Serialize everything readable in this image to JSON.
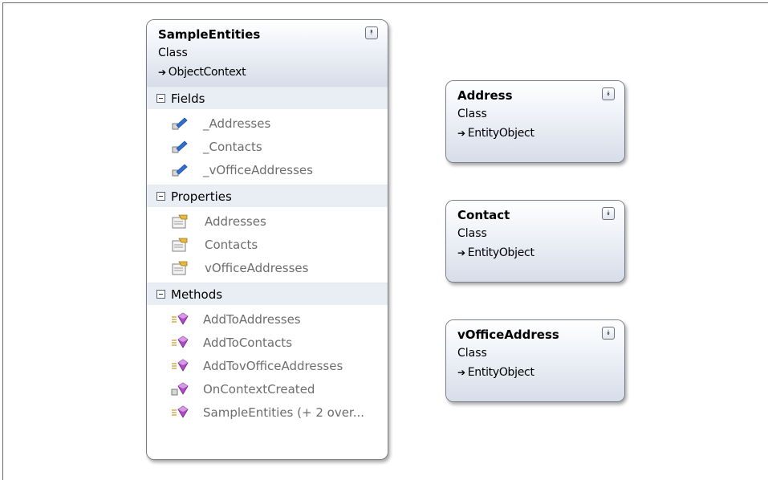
{
  "classes": {
    "sample_entities": {
      "name": "SampleEntities",
      "kind": "Class",
      "base": "ObjectContext",
      "sections": {
        "fields": {
          "title": "Fields",
          "items": [
            "_Addresses",
            "_Contacts",
            "_vOfficeAddresses"
          ]
        },
        "properties": {
          "title": "Properties",
          "items": [
            "Addresses",
            "Contacts",
            "vOfficeAddresses"
          ]
        },
        "methods": {
          "title": "Methods",
          "items": [
            "AddToAddresses",
            "AddToContacts",
            "AddTovOfficeAddresses",
            "OnContextCreated",
            "SampleEntities (+ 2 over..."
          ]
        }
      }
    },
    "address": {
      "name": "Address",
      "kind": "Class",
      "base": "EntityObject"
    },
    "contact": {
      "name": "Contact",
      "kind": "Class",
      "base": "EntityObject"
    },
    "voffice_address": {
      "name": "vOfficeAddress",
      "kind": "Class",
      "base": "EntityObject"
    }
  },
  "icons": {
    "collapse": "chevron-up-icon",
    "expand": "chevron-down-icon",
    "field": "field-icon",
    "property": "property-icon",
    "method": "method-icon",
    "protected_method": "protected-method-icon"
  },
  "colors": {
    "header_gradient_end": "#d7dde9",
    "section_header": "#e9edf4",
    "member_text": "#6d6d6d",
    "method_icon": "#9b35b0",
    "field_icon": "#2f6fd1"
  }
}
